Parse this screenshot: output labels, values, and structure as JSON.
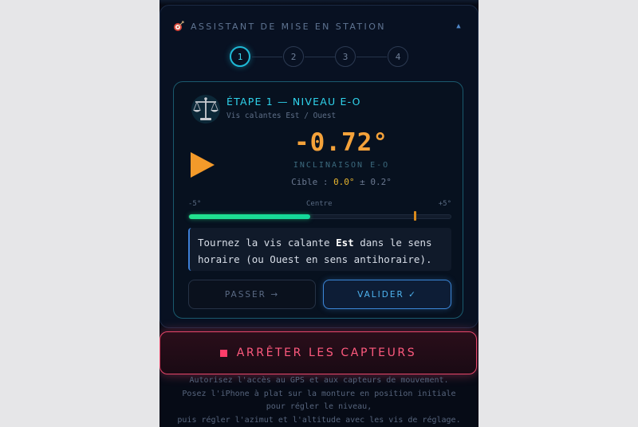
{
  "panel": {
    "title": "ASSISTANT DE MISE EN STATION",
    "icons": {
      "target": "target-icon",
      "collapse": "chevron-up-icon"
    },
    "collapse_glyph": "▲",
    "steps": [
      "1",
      "2",
      "3",
      "4"
    ],
    "active_step": 1
  },
  "card": {
    "title": "ÉTAPE 1 — NIVEAU E-O",
    "subtitle": "Vis calantes Est / Ouest",
    "icons": {
      "step": "scale-icon",
      "direction": "play-right-icon"
    },
    "value": "-0.72°",
    "value_label": "INCLINAISON E-O",
    "target_prefix": "Cible : ",
    "target_value": "0.0°",
    "target_suffix": " ± 0.2°",
    "range_min": "-5°",
    "range_center": "Centre",
    "range_max": "+5°",
    "level_fill_fraction": 0.46,
    "marker_fraction": 0.855,
    "instruction_1": "Tournez la vis calante ",
    "instruction_bold": "Est",
    "instruction_2": " dans le sens horaire (ou Ouest en sens antihoraire).",
    "skip_label": "PASSER →",
    "validate_label": "VALIDER ✓"
  },
  "stop_button": {
    "label": "ARRÊTER LES CAPTEURS"
  },
  "footer": {
    "line1": "Autorisez l'accès au GPS et aux capteurs de mouvement.",
    "line2": "Posez l'iPhone à plat sur la monture en position initiale",
    "line3": "pour régler le niveau,",
    "line4": "puis régler l'azimut et l'altitude avec les vis de réglage."
  },
  "colors": {
    "accent_cyan": "#2fd3ec",
    "value_orange": "#f4a23a",
    "level_green": "#22e38e",
    "stop_red": "#ff3d6a",
    "validate_blue": "#3b86d8"
  }
}
